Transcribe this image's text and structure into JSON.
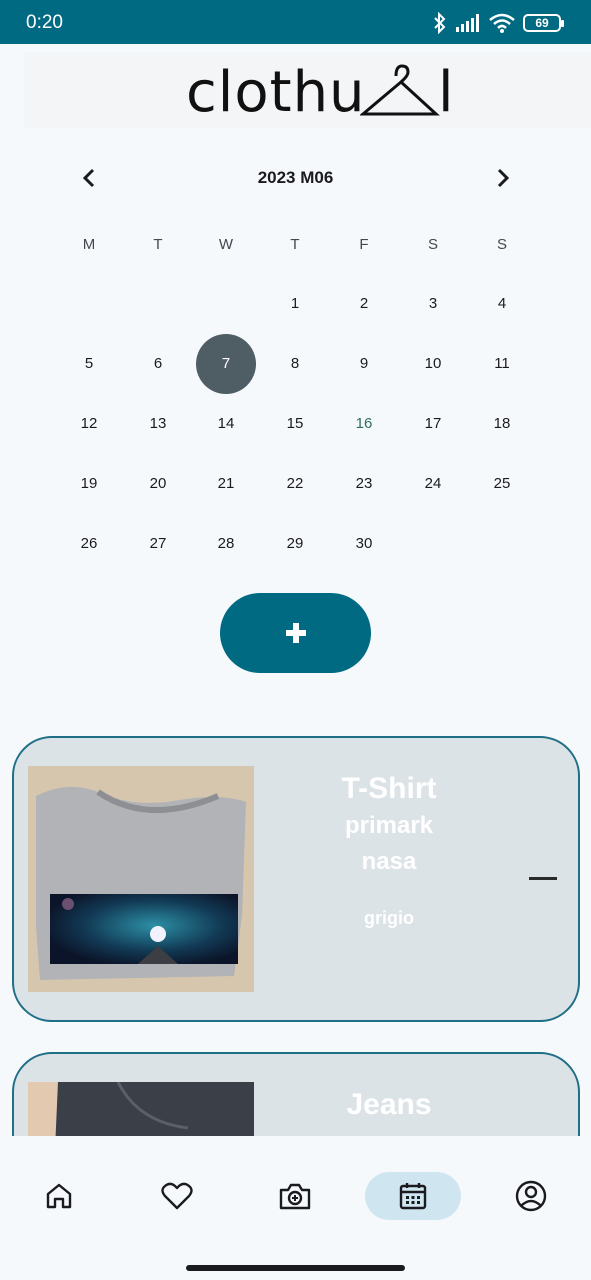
{
  "status_bar": {
    "time": "0:20",
    "battery": "69",
    "icons": [
      "bluetooth-icon",
      "signal-icon",
      "wifi-icon",
      "battery-icon"
    ]
  },
  "logo": {
    "text": "clothu",
    "suffix": "l"
  },
  "calendar": {
    "month_label": "2023 M06",
    "weekdays": [
      "M",
      "T",
      "W",
      "T",
      "F",
      "S",
      "S"
    ],
    "days": [
      "1",
      "2",
      "3",
      "4",
      "5",
      "6",
      "7",
      "8",
      "9",
      "10",
      "11",
      "12",
      "13",
      "14",
      "15",
      "16",
      "17",
      "18",
      "19",
      "20",
      "21",
      "22",
      "23",
      "24",
      "25",
      "26",
      "27",
      "28",
      "29",
      "30"
    ],
    "first_weekday_index": 3,
    "selected_day": "7",
    "today": "16"
  },
  "add_button": {
    "icon": "plus-icon"
  },
  "items": [
    {
      "type": "T-Shirt",
      "brand": "primark",
      "model": "nasa",
      "color": "grigio"
    },
    {
      "type": "Jeans"
    }
  ],
  "bottom_nav": {
    "items": [
      "home-icon",
      "heart-icon",
      "camera-icon",
      "calendar-icon",
      "profile-icon"
    ],
    "active": "calendar-icon"
  },
  "colors": {
    "accent": "#006a83",
    "selected_day": "#4f5d65",
    "card_bg": "#dce3e7",
    "nav_active": "#cfe6f1"
  }
}
